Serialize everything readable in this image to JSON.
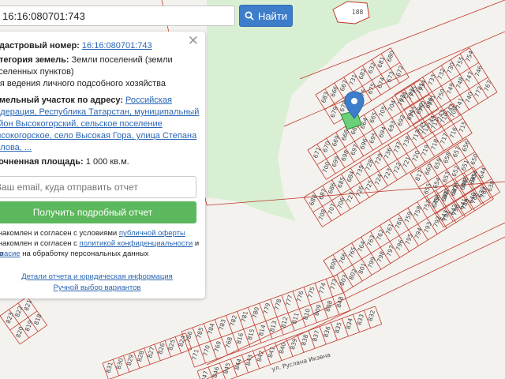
{
  "search": {
    "value": "16:16:080701:743",
    "button_label": "Найти"
  },
  "card": {
    "cadastral_label": "Кадастровый номер:",
    "cadastral_value": "16:16:080701:743",
    "category_label": "Категория земель:",
    "category_value_1": "Земли поселений (земли",
    "category_value_2": "населенных пунктов)",
    "use_value": "Для ведения личного подсобного хозяйства",
    "address_label": "Земельный участок по адресу:",
    "address_line_1": "Российская",
    "address_line_2": "Федерация, Республика Татарстан, муниципальный",
    "address_line_3": "район Высокогорский, сельское поселение",
    "address_line_4": "Высокогорское, село Высокая Гора, улица Степана",
    "address_line_5": "Орлова, ...",
    "area_label": "Уточненная площадь:",
    "area_value": "1 000 кв.м.",
    "email_placeholder": "Ваш email, куда отправить отчет",
    "get_report_label": "Получить подробный отчет",
    "agree_1a": "Ознакомлен и согласен с условиями",
    "agree_1b": "публичной оферты",
    "agree_2a": "Ознакомлен и согласен с",
    "agree_2b": "политикой конфиденциальности",
    "agree_2c": "и даю",
    "agree_3a": "согласие",
    "agree_3b": "на обработку персональных данных",
    "details_link": "Детали отчета и юридическая информация",
    "manual_link": "Ручной выбор вариантов"
  },
  "map": {
    "street_name": "ул. Руслана Икэвна",
    "forest_label": "188",
    "parcel_labels": [
      "683",
      "666",
      "667",
      "731",
      "682",
      "632",
      "681",
      "680",
      "679",
      "678",
      "677",
      "676",
      "675",
      "674",
      "673",
      "672",
      "671",
      "670",
      "669",
      "668",
      "663",
      "664",
      "665",
      "705",
      "704",
      "703",
      "702",
      "701",
      "700",
      "699",
      "698",
      "697",
      "696",
      "695",
      "694",
      "693",
      "692",
      "691",
      "690",
      "689",
      "688",
      "687",
      "686",
      "685",
      "684",
      "739",
      "728",
      "729",
      "736",
      "737",
      "738",
      "713",
      "712",
      "711",
      "710",
      "709",
      "708",
      "707",
      "706",
      "727",
      "726",
      "725",
      "724",
      "723",
      "722",
      "721",
      "720",
      "719",
      "718",
      "717",
      "716",
      "715",
      "714",
      "735",
      "734",
      "733",
      "732",
      "730",
      "755",
      "754",
      "753",
      "752",
      "751",
      "750",
      "749",
      "748",
      "747",
      "746",
      "745",
      "744",
      "743",
      "742",
      "741",
      "740",
      "772",
      "767",
      "800",
      "766",
      "765",
      "764",
      "763",
      "762",
      "761",
      "760",
      "759",
      "758",
      "757",
      "756",
      "807",
      "806",
      "805",
      "804",
      "803",
      "802",
      "801",
      "799",
      "798",
      "797",
      "796",
      "795",
      "794",
      "793",
      "792",
      "791",
      "790",
      "789",
      "788",
      "787",
      "786",
      "785",
      "784",
      "783",
      "782",
      "781",
      "780",
      "779",
      "778",
      "777",
      "776",
      "775",
      "774",
      "773",
      "771",
      "770",
      "769",
      "768",
      "816",
      "815",
      "814",
      "813",
      "812",
      "811",
      "810",
      "809",
      "808",
      "848",
      "847",
      "846",
      "845",
      "844",
      "843",
      "842",
      "841",
      "840",
      "839",
      "838",
      "837",
      "836",
      "835",
      "834",
      "833",
      "832",
      "831",
      "830",
      "829",
      "828",
      "827",
      "826",
      "825",
      "824",
      "823",
      "822",
      "821",
      "820",
      "819",
      "818",
      "817",
      "660",
      "659",
      "658",
      "657",
      "656",
      "655",
      "654",
      "653",
      "652",
      "651",
      "650",
      "649",
      "648",
      "647",
      "646",
      "645",
      "644",
      "643",
      "642",
      "641",
      "640",
      "639",
      "638",
      "637",
      "636",
      "635",
      "634",
      "633",
      "919",
      "920",
      "921",
      "922",
      "923",
      "924",
      "917",
      "918",
      "516",
      "517",
      "518",
      "519",
      "520",
      "346",
      "1436"
    ]
  },
  "colors": {
    "accent": "#3d7dca",
    "success": "#5cb85c",
    "parcel_stroke": "#c0392b",
    "forest": "#d9efd3",
    "selected": "#6ccf7a"
  }
}
